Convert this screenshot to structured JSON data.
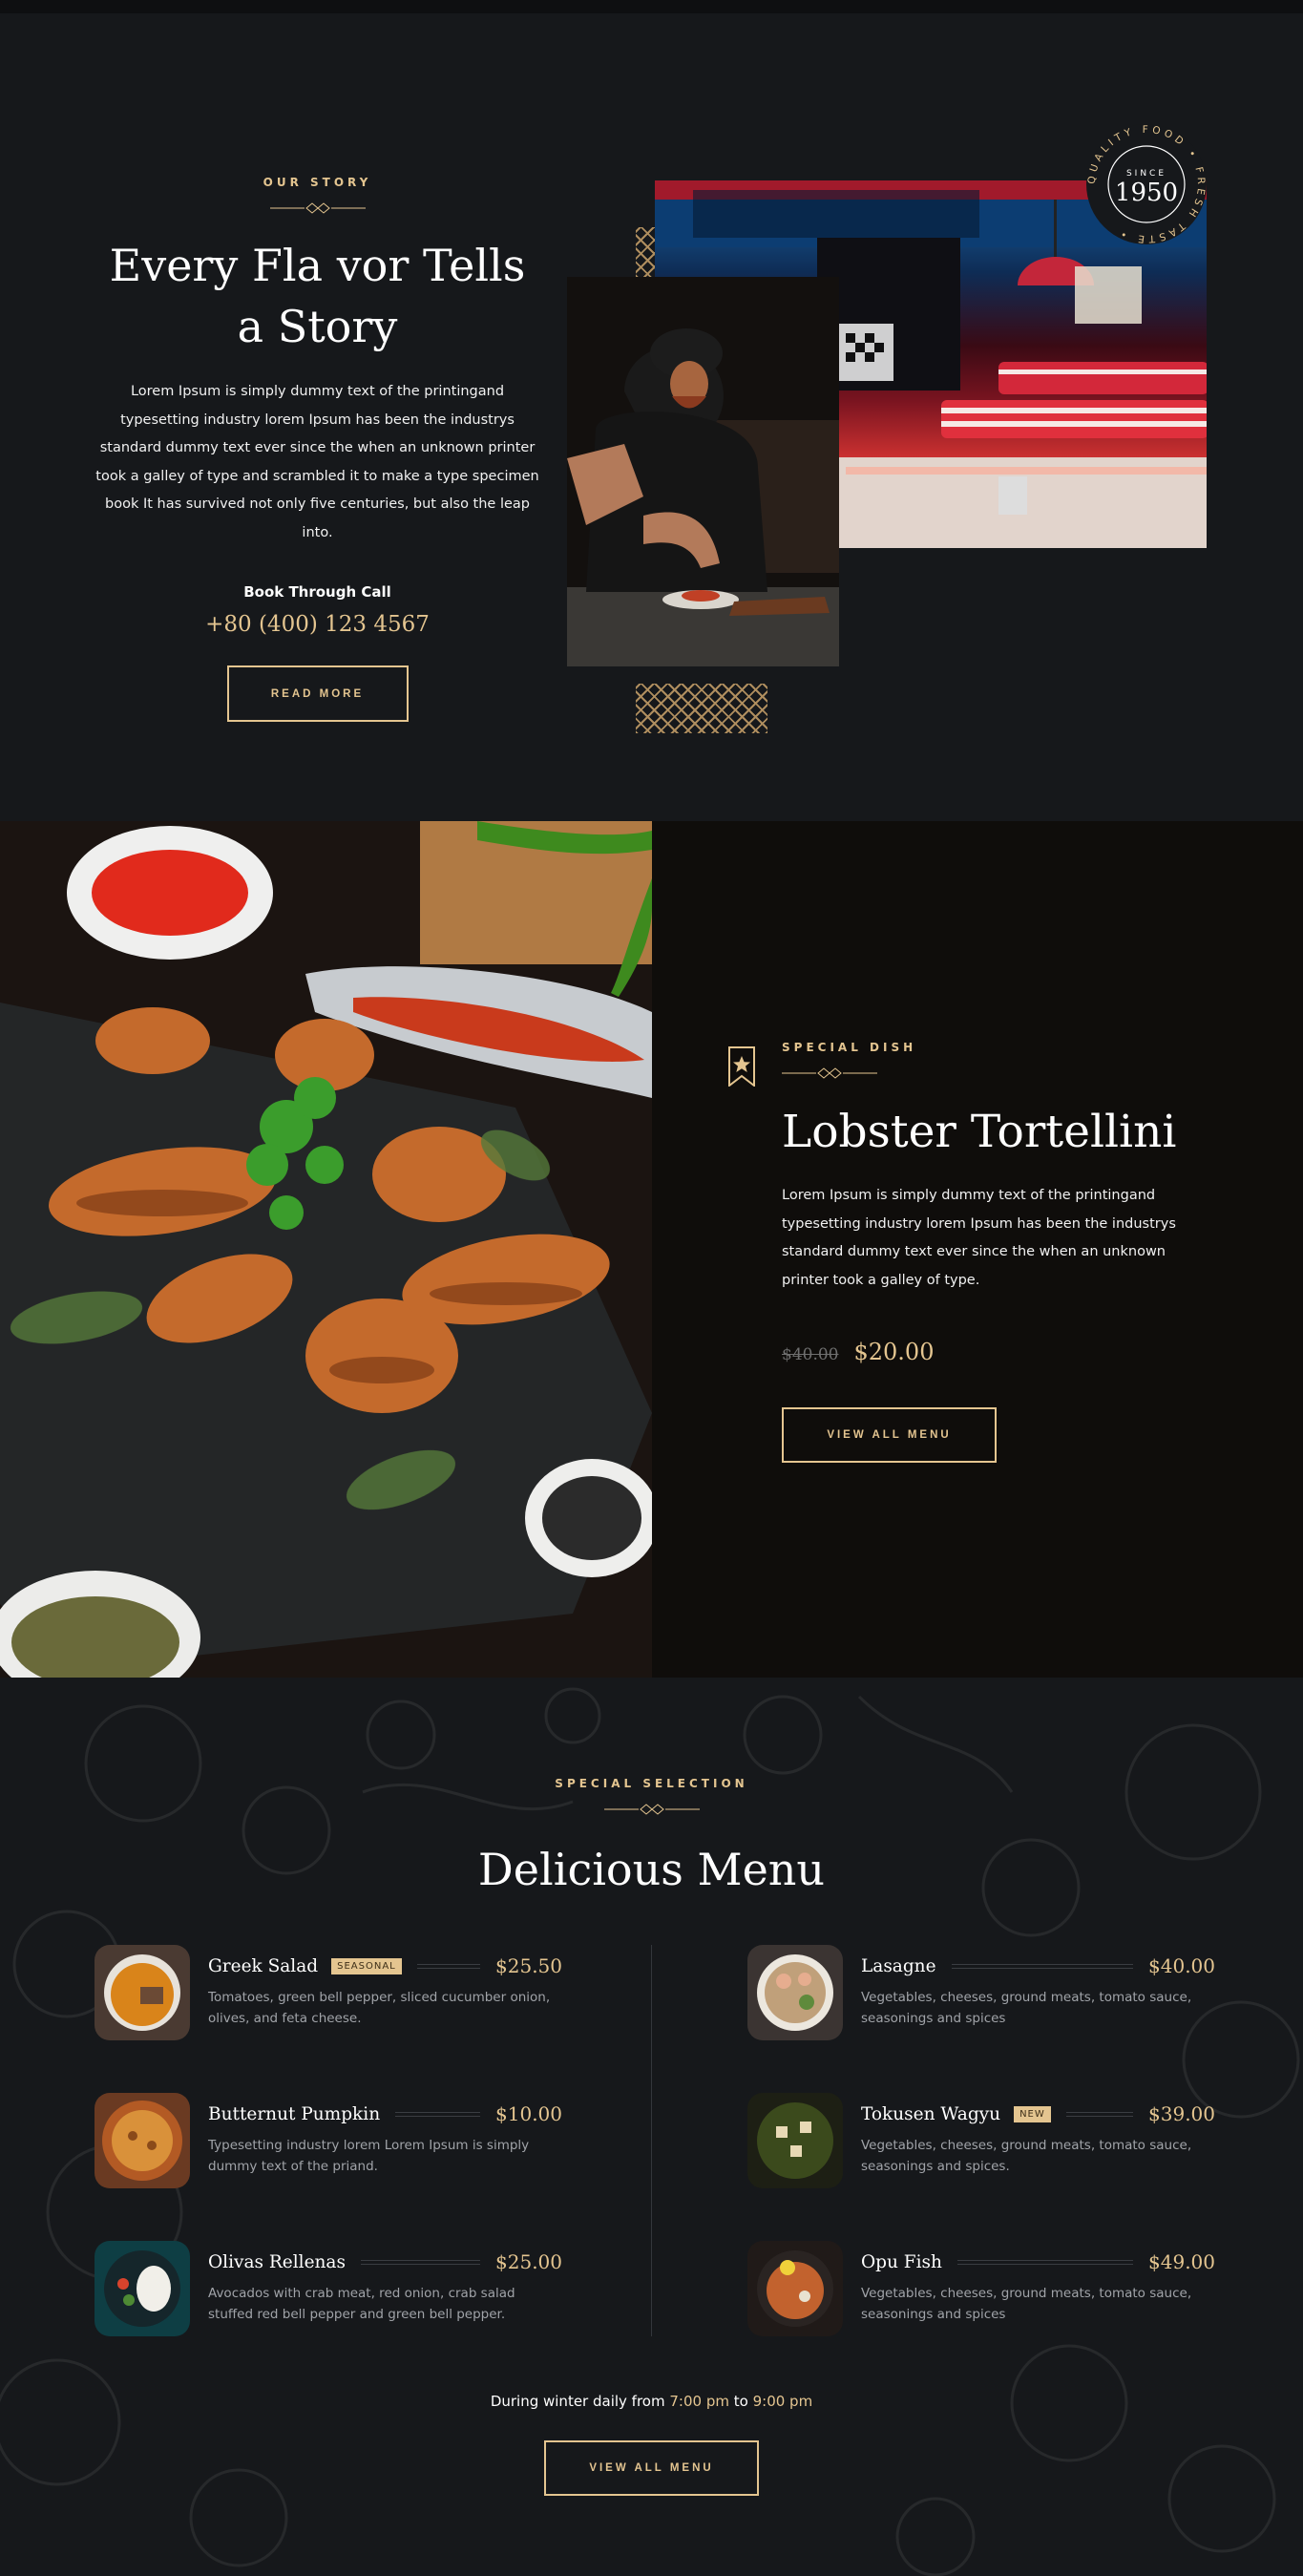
{
  "story": {
    "eyebrow": "OUR STORY",
    "title": "Every Fla vor Tells a Story",
    "body": "Lorem Ipsum is simply dummy text of the printingand typesetting industry lorem Ipsum has been the industrys standard dummy text ever since the when an unknown printer took a galley of type and scrambled it to make a type specimen book It has survived not only five centuries, but also the leap into.",
    "call_label": "Book Through Call",
    "call_number": "+80 (400) 123 4567",
    "button_label": "READ MORE",
    "badge": {
      "ring_text": "QUALITY FOOD • FRESH TASTE •",
      "since_label": "SINCE",
      "year": "1950"
    }
  },
  "special": {
    "eyebrow": "SPECIAL DISH",
    "title": "Lobster Tortellini",
    "body": "Lorem Ipsum is simply dummy text of the printingand typesetting industry lorem Ipsum has been the industrys standard dummy text ever since the when an unknown printer took a galley of type.",
    "old_price": "$40.00",
    "new_price": "$20.00",
    "button_label": "VIEW ALL MENU"
  },
  "menu": {
    "eyebrow": "SPECIAL SELECTION",
    "title": "Delicious Menu",
    "items": [
      {
        "name": "Greek Salad",
        "tag": "SEASONAL",
        "price": "$25.50",
        "desc": "Tomatoes, green bell pepper, sliced cucumber onion, olives, and feta cheese."
      },
      {
        "name": "Lasagne",
        "tag": "",
        "price": "$40.00",
        "desc": "Vegetables, cheeses, ground meats, tomato sauce, seasonings and spices"
      },
      {
        "name": "Butternut Pumpkin",
        "tag": "",
        "price": "$10.00",
        "desc": "Typesetting industry lorem Lorem Ipsum is simply dummy text of the priand."
      },
      {
        "name": "Tokusen Wagyu",
        "tag": "NEW",
        "price": "$39.00",
        "desc": "Vegetables, cheeses, ground meats, tomato sauce, seasonings and spices."
      },
      {
        "name": "Olivas Rellenas",
        "tag": "",
        "price": "$25.00",
        "desc": "Avocados with crab meat, red onion, crab salad stuffed red bell pepper and green bell pepper."
      },
      {
        "name": "Opu Fish",
        "tag": "",
        "price": "$49.00",
        "desc": "Vegetables, cheeses, ground meats, tomato sauce, seasonings and spices"
      }
    ],
    "hours_prefix": "During winter daily from",
    "hours_start": "7:00 pm",
    "hours_mid": "to",
    "hours_end": "9:00 pm",
    "button_label": "VIEW ALL MENU"
  },
  "colors": {
    "accent": "#e4c590",
    "background": "#16181b",
    "special_background": "#0f0d0b"
  }
}
